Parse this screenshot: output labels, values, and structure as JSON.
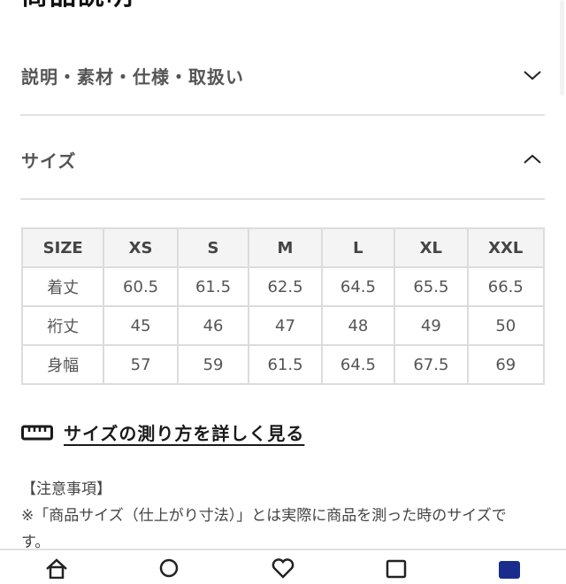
{
  "section": {
    "title": "商品説明"
  },
  "accordion": [
    {
      "label": "説明・素材・仕様・取扱い",
      "state": "collapsed",
      "icon": "chevron-down-icon"
    },
    {
      "label": "サイズ",
      "state": "expanded",
      "icon": "chevron-up-icon"
    }
  ],
  "size_table": {
    "headers": [
      "SIZE",
      "XS",
      "S",
      "M",
      "L",
      "XL",
      "XXL"
    ],
    "rows": [
      {
        "label": "着丈",
        "values": [
          "60.5",
          "61.5",
          "62.5",
          "64.5",
          "65.5",
          "66.5"
        ]
      },
      {
        "label": "裄丈",
        "values": [
          "45",
          "46",
          "47",
          "48",
          "49",
          "50"
        ]
      },
      {
        "label": "身幅",
        "values": [
          "57",
          "59",
          "61.5",
          "64.5",
          "67.5",
          "69"
        ]
      }
    ]
  },
  "measure_link": {
    "icon": "ruler-icon",
    "label": "サイズの測り方を詳しく見る"
  },
  "notes": {
    "heading": "【注意事項】",
    "line1": "※「商品サイズ（仕上がり寸法）」とは実際に商品を測った時のサイズで",
    "line2": "す。"
  },
  "bottom_nav": [
    {
      "name": "home",
      "icon": "home-icon"
    },
    {
      "name": "search",
      "icon": "search-icon"
    },
    {
      "name": "favorites",
      "icon": "heart-icon"
    },
    {
      "name": "cart",
      "icon": "cart-icon"
    },
    {
      "name": "account",
      "icon": "account-icon",
      "color": "#1a2c8c"
    }
  ]
}
